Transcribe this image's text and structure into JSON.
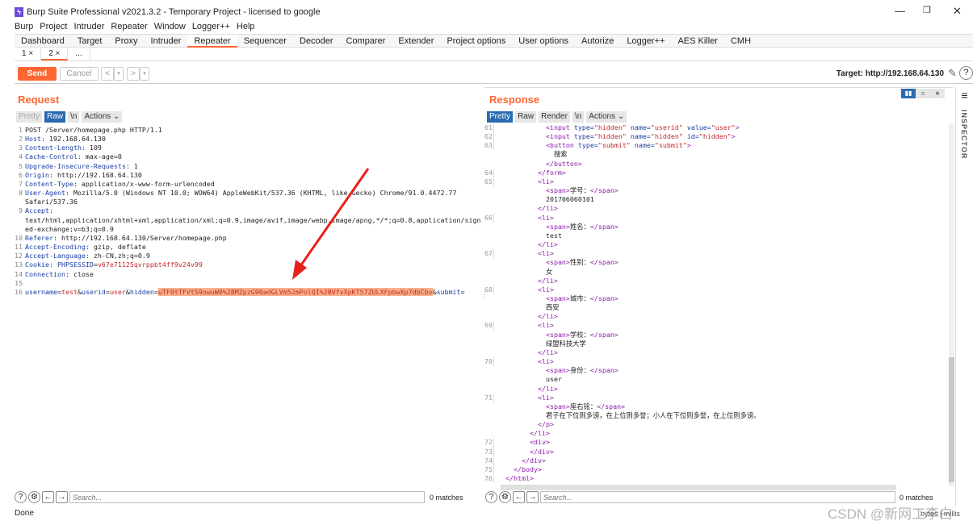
{
  "window": {
    "title": "Burp Suite Professional v2021.3.2 - Temporary Project - licensed to google",
    "logo": "burp-logo",
    "minimize": "—",
    "restore": "❐",
    "close": "✕"
  },
  "menu": [
    "Burp",
    "Project",
    "Intruder",
    "Repeater",
    "Window",
    "Logger++",
    "Help"
  ],
  "tabs": [
    "Dashboard",
    "Target",
    "Proxy",
    "Intruder",
    "Repeater",
    "Sequencer",
    "Decoder",
    "Comparer",
    "Extender",
    "Project options",
    "User options",
    "Autorize",
    "Logger++",
    "AES Killer",
    "CMH"
  ],
  "active_tab": "Repeater",
  "subtabs": [
    {
      "label": "1 ×"
    },
    {
      "label": "2 ×",
      "active": true
    },
    {
      "label": "..."
    }
  ],
  "toolbar": {
    "send": "Send",
    "cancel": "Cancel",
    "back": "<",
    "back_menu": "▾",
    "fwd": ">",
    "fwd_menu": "▾",
    "target": "Target: http://192.168.64.130"
  },
  "request": {
    "title": "Request",
    "views": [
      "Pretty",
      "Raw",
      "\\n",
      "Actions ⌄"
    ],
    "selected_view": "Raw",
    "lines": [
      {
        "n": "1",
        "s": [
          [
            "tx",
            "POST /Server/homepage.php HTTP/1.1"
          ]
        ]
      },
      {
        "n": "2",
        "s": [
          [
            "k",
            "Host:"
          ],
          [
            "tx",
            " 192.168.64.130"
          ]
        ]
      },
      {
        "n": "3",
        "s": [
          [
            "k",
            "Content-Length:"
          ],
          [
            "tx",
            " 109"
          ]
        ]
      },
      {
        "n": "4",
        "s": [
          [
            "k",
            "Cache-Control:"
          ],
          [
            "tx",
            " max-age=0"
          ]
        ]
      },
      {
        "n": "5",
        "s": [
          [
            "k",
            "Upgrade-Insecure-Requests:"
          ],
          [
            "tx",
            " 1"
          ]
        ]
      },
      {
        "n": "6",
        "s": [
          [
            "k",
            "Origin:"
          ],
          [
            "tx",
            " http://192.168.64.130"
          ]
        ]
      },
      {
        "n": "7",
        "s": [
          [
            "k",
            "Content-Type:"
          ],
          [
            "tx",
            " application/x-www-form-urlencoded"
          ]
        ]
      },
      {
        "n": "8",
        "s": [
          [
            "k",
            "User-Agent:"
          ],
          [
            "tx",
            " Mozilla/5.0 (Windows NT 10.0; WOW64) AppleWebKit/537.36 (KHTML, like Gecko) Chrome/91.0.4472.77"
          ]
        ]
      },
      {
        "n": "",
        "s": [
          [
            "tx",
            "Safari/537.36"
          ]
        ]
      },
      {
        "n": "9",
        "s": [
          [
            "k",
            "Accept:"
          ]
        ]
      },
      {
        "n": "",
        "s": [
          [
            "tx",
            "text/html,application/xhtml+xml,application/xml;q=0.9,image/avif,image/webp,image/apng,*/*;q=0.8,application/sign"
          ]
        ]
      },
      {
        "n": "",
        "s": [
          [
            "tx",
            "ed-exchange;v=b3;q=0.9"
          ]
        ]
      },
      {
        "n": "10",
        "s": [
          [
            "k",
            "Referer:"
          ],
          [
            "tx",
            " http://192.168.64.130/Server/homepage.php"
          ]
        ]
      },
      {
        "n": "11",
        "s": [
          [
            "k",
            "Accept-Encoding:"
          ],
          [
            "tx",
            " gzip, deflate"
          ]
        ]
      },
      {
        "n": "12",
        "s": [
          [
            "k",
            "Accept-Language:"
          ],
          [
            "tx",
            " zh-CN,zh;q=0.9"
          ]
        ]
      },
      {
        "n": "13",
        "s": [
          [
            "k",
            "Cookie:"
          ],
          [
            "tx",
            " "
          ],
          [
            "k",
            "PHPSESSID"
          ],
          [
            "tx",
            "="
          ],
          [
            "v",
            "v67e71125qvrppbt4ff9v24v99"
          ]
        ]
      },
      {
        "n": "14",
        "s": [
          [
            "k",
            "Connection:"
          ],
          [
            "tx",
            " close"
          ]
        ]
      },
      {
        "n": "15",
        "s": []
      },
      {
        "n": "16",
        "s": [
          [
            "k",
            "username"
          ],
          [
            "tx",
            "="
          ],
          [
            "v",
            "test"
          ],
          [
            "tx",
            "&"
          ],
          [
            "k",
            "userid"
          ],
          [
            "tx",
            "="
          ],
          [
            "v",
            "user"
          ],
          [
            "tx",
            "&"
          ],
          [
            "k",
            "hidden"
          ],
          [
            "tx",
            "="
          ],
          [
            "hl",
            "uTF0tTFVtS9owuW0%2BMZpzG90adGLVm52mPolQI%2BVfvXpKT57ZULXFpbwXp7dbCbv"
          ],
          [
            "tx",
            "&"
          ],
          [
            "k",
            "submit"
          ],
          [
            "tx",
            "="
          ]
        ]
      }
    ],
    "search_placeholder": "Search...",
    "matches": "0 matches"
  },
  "response": {
    "title": "Response",
    "views": [
      "Pretty",
      "Raw",
      "Render",
      "\\n",
      "Actions ⌄"
    ],
    "selected_view": "Pretty",
    "lines": [
      {
        "n": "61",
        "i": 12,
        "s": [
          [
            "tag",
            "<input "
          ],
          [
            "at",
            "type="
          ],
          [
            "av",
            "\"hidden\" "
          ],
          [
            "at",
            "name="
          ],
          [
            "av",
            "\"userid\" "
          ],
          [
            "at",
            "value="
          ],
          [
            "av",
            "\"user\""
          ],
          [
            "tag",
            ">"
          ]
        ]
      },
      {
        "n": "62",
        "i": 12,
        "s": [
          [
            "tag",
            "<input "
          ],
          [
            "at",
            "type="
          ],
          [
            "av",
            "\"hidden\" "
          ],
          [
            "at",
            "name="
          ],
          [
            "av",
            "\"hidden\" "
          ],
          [
            "at",
            "id="
          ],
          [
            "av",
            "\"hidden\""
          ],
          [
            "tag",
            ">"
          ]
        ]
      },
      {
        "n": "63",
        "i": 12,
        "s": [
          [
            "tag",
            "<button "
          ],
          [
            "at",
            "type="
          ],
          [
            "av",
            "\"submit\" "
          ],
          [
            "at",
            "name="
          ],
          [
            "av",
            "\"submit\""
          ],
          [
            "tag",
            ">"
          ]
        ]
      },
      {
        "n": "",
        "i": 14,
        "s": [
          [
            "tx",
            "搜索"
          ]
        ]
      },
      {
        "n": "",
        "i": 12,
        "s": [
          [
            "tag",
            "</button>"
          ]
        ]
      },
      {
        "n": "64",
        "i": 10,
        "s": [
          [
            "tag",
            "</form>"
          ]
        ]
      },
      {
        "n": "65",
        "i": 10,
        "s": [
          [
            "tag",
            "<li>"
          ]
        ]
      },
      {
        "n": "",
        "i": 12,
        "s": [
          [
            "tag",
            "<span>"
          ],
          [
            "tx",
            "学号："
          ],
          [
            "tag",
            "</span>"
          ]
        ]
      },
      {
        "n": "",
        "i": 12,
        "s": [
          [
            "tx",
            "201706060101"
          ]
        ]
      },
      {
        "n": "",
        "i": 10,
        "s": [
          [
            "tag",
            "</li>"
          ]
        ]
      },
      {
        "n": "66",
        "i": 10,
        "s": [
          [
            "tag",
            "<li>"
          ]
        ]
      },
      {
        "n": "",
        "i": 12,
        "s": [
          [
            "tag",
            "<span>"
          ],
          [
            "tx",
            "姓名："
          ],
          [
            "tag",
            "</span>"
          ]
        ]
      },
      {
        "n": "",
        "i": 12,
        "s": [
          [
            "tx",
            "test"
          ]
        ]
      },
      {
        "n": "",
        "i": 10,
        "s": [
          [
            "tag",
            "</li>"
          ]
        ]
      },
      {
        "n": "67",
        "i": 10,
        "s": [
          [
            "tag",
            "<li>"
          ]
        ]
      },
      {
        "n": "",
        "i": 12,
        "s": [
          [
            "tag",
            "<span>"
          ],
          [
            "tx",
            "性别："
          ],
          [
            "tag",
            "</span>"
          ]
        ]
      },
      {
        "n": "",
        "i": 12,
        "s": [
          [
            "tx",
            "女"
          ]
        ]
      },
      {
        "n": "",
        "i": 10,
        "s": [
          [
            "tag",
            "</li>"
          ]
        ]
      },
      {
        "n": "68",
        "i": 10,
        "s": [
          [
            "tag",
            "<li>"
          ]
        ]
      },
      {
        "n": "",
        "i": 12,
        "s": [
          [
            "tag",
            "<span>"
          ],
          [
            "tx",
            "城市："
          ],
          [
            "tag",
            "</span>"
          ]
        ]
      },
      {
        "n": "",
        "i": 12,
        "s": [
          [
            "tx",
            "西安"
          ]
        ]
      },
      {
        "n": "",
        "i": 10,
        "s": [
          [
            "tag",
            "</li>"
          ]
        ]
      },
      {
        "n": "69",
        "i": 10,
        "s": [
          [
            "tag",
            "<li>"
          ]
        ]
      },
      {
        "n": "",
        "i": 12,
        "s": [
          [
            "tag",
            "<span>"
          ],
          [
            "tx",
            "学校："
          ],
          [
            "tag",
            "</span>"
          ]
        ]
      },
      {
        "n": "",
        "i": 12,
        "s": [
          [
            "tx",
            "绿盟科技大学"
          ]
        ]
      },
      {
        "n": "",
        "i": 10,
        "s": [
          [
            "tag",
            "</li>"
          ]
        ]
      },
      {
        "n": "70",
        "i": 10,
        "s": [
          [
            "tag",
            "<li>"
          ]
        ]
      },
      {
        "n": "",
        "i": 12,
        "s": [
          [
            "tag",
            "<span>"
          ],
          [
            "tx",
            "身份："
          ],
          [
            "tag",
            "</span>"
          ]
        ]
      },
      {
        "n": "",
        "i": 12,
        "s": [
          [
            "tx",
            "user"
          ]
        ]
      },
      {
        "n": "",
        "i": 10,
        "s": [
          [
            "tag",
            "</li>"
          ]
        ]
      },
      {
        "n": "71",
        "i": 10,
        "s": [
          [
            "tag",
            "<li>"
          ]
        ]
      },
      {
        "n": "",
        "i": 12,
        "s": [
          [
            "tag",
            "<span>"
          ],
          [
            "tx",
            "座右铭："
          ],
          [
            "tag",
            "</span>"
          ]
        ]
      },
      {
        "n": "",
        "i": 12,
        "s": [
          [
            "tx",
            "君子在下位则多谤，在上位则多誉；小人在下位则多誉，在上位则多谤。"
          ]
        ]
      },
      {
        "n": "",
        "i": 10,
        "s": [
          [
            "tag",
            "</p>"
          ]
        ]
      },
      {
        "n": "",
        "i": 8,
        "s": [
          [
            "tag",
            "</li>"
          ]
        ]
      },
      {
        "n": "72",
        "i": 8,
        "s": [
          [
            "tag",
            "<div>"
          ]
        ]
      },
      {
        "n": "73",
        "i": 8,
        "s": [
          [
            "tag",
            "</div>"
          ]
        ]
      },
      {
        "n": "74",
        "i": 6,
        "s": [
          [
            "tag",
            "</div>"
          ]
        ]
      },
      {
        "n": "75",
        "i": 4,
        "s": [
          [
            "tag",
            "</body>"
          ]
        ]
      },
      {
        "n": "76",
        "i": 2,
        "s": [
          [
            "tag",
            "</html>"
          ]
        ]
      }
    ],
    "search_placeholder": "Search...",
    "matches": "0 matches"
  },
  "inspector": {
    "label": "INSPECTOR"
  },
  "status": {
    "left": "Done",
    "right": "bytes | millis"
  },
  "watermark": "CSDN @新网工李白",
  "colors": {
    "accent": "#ff6633",
    "selected": "#2a6bb0",
    "highlight": "#f9b08a",
    "arrow": "#e8201c"
  }
}
